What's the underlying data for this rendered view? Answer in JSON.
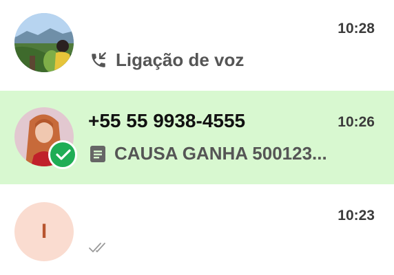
{
  "chats": [
    {
      "time": "10:28",
      "preview": "Ligação de voz",
      "preview_icon": "missed-voice-call-icon",
      "avatar": "photo-avatar"
    },
    {
      "name": "+55 55 9938-4555",
      "time": "10:26",
      "preview": "CAUSA GANHA 500123...",
      "preview_icon": "document-icon",
      "avatar": "photo-avatar",
      "badge": "verified-check-icon",
      "highlight_color": "#d8f8d0"
    },
    {
      "time": "10:23",
      "initial": "I",
      "status_icon": "double-check-icon",
      "avatar_color": "#fadcd0"
    }
  ]
}
